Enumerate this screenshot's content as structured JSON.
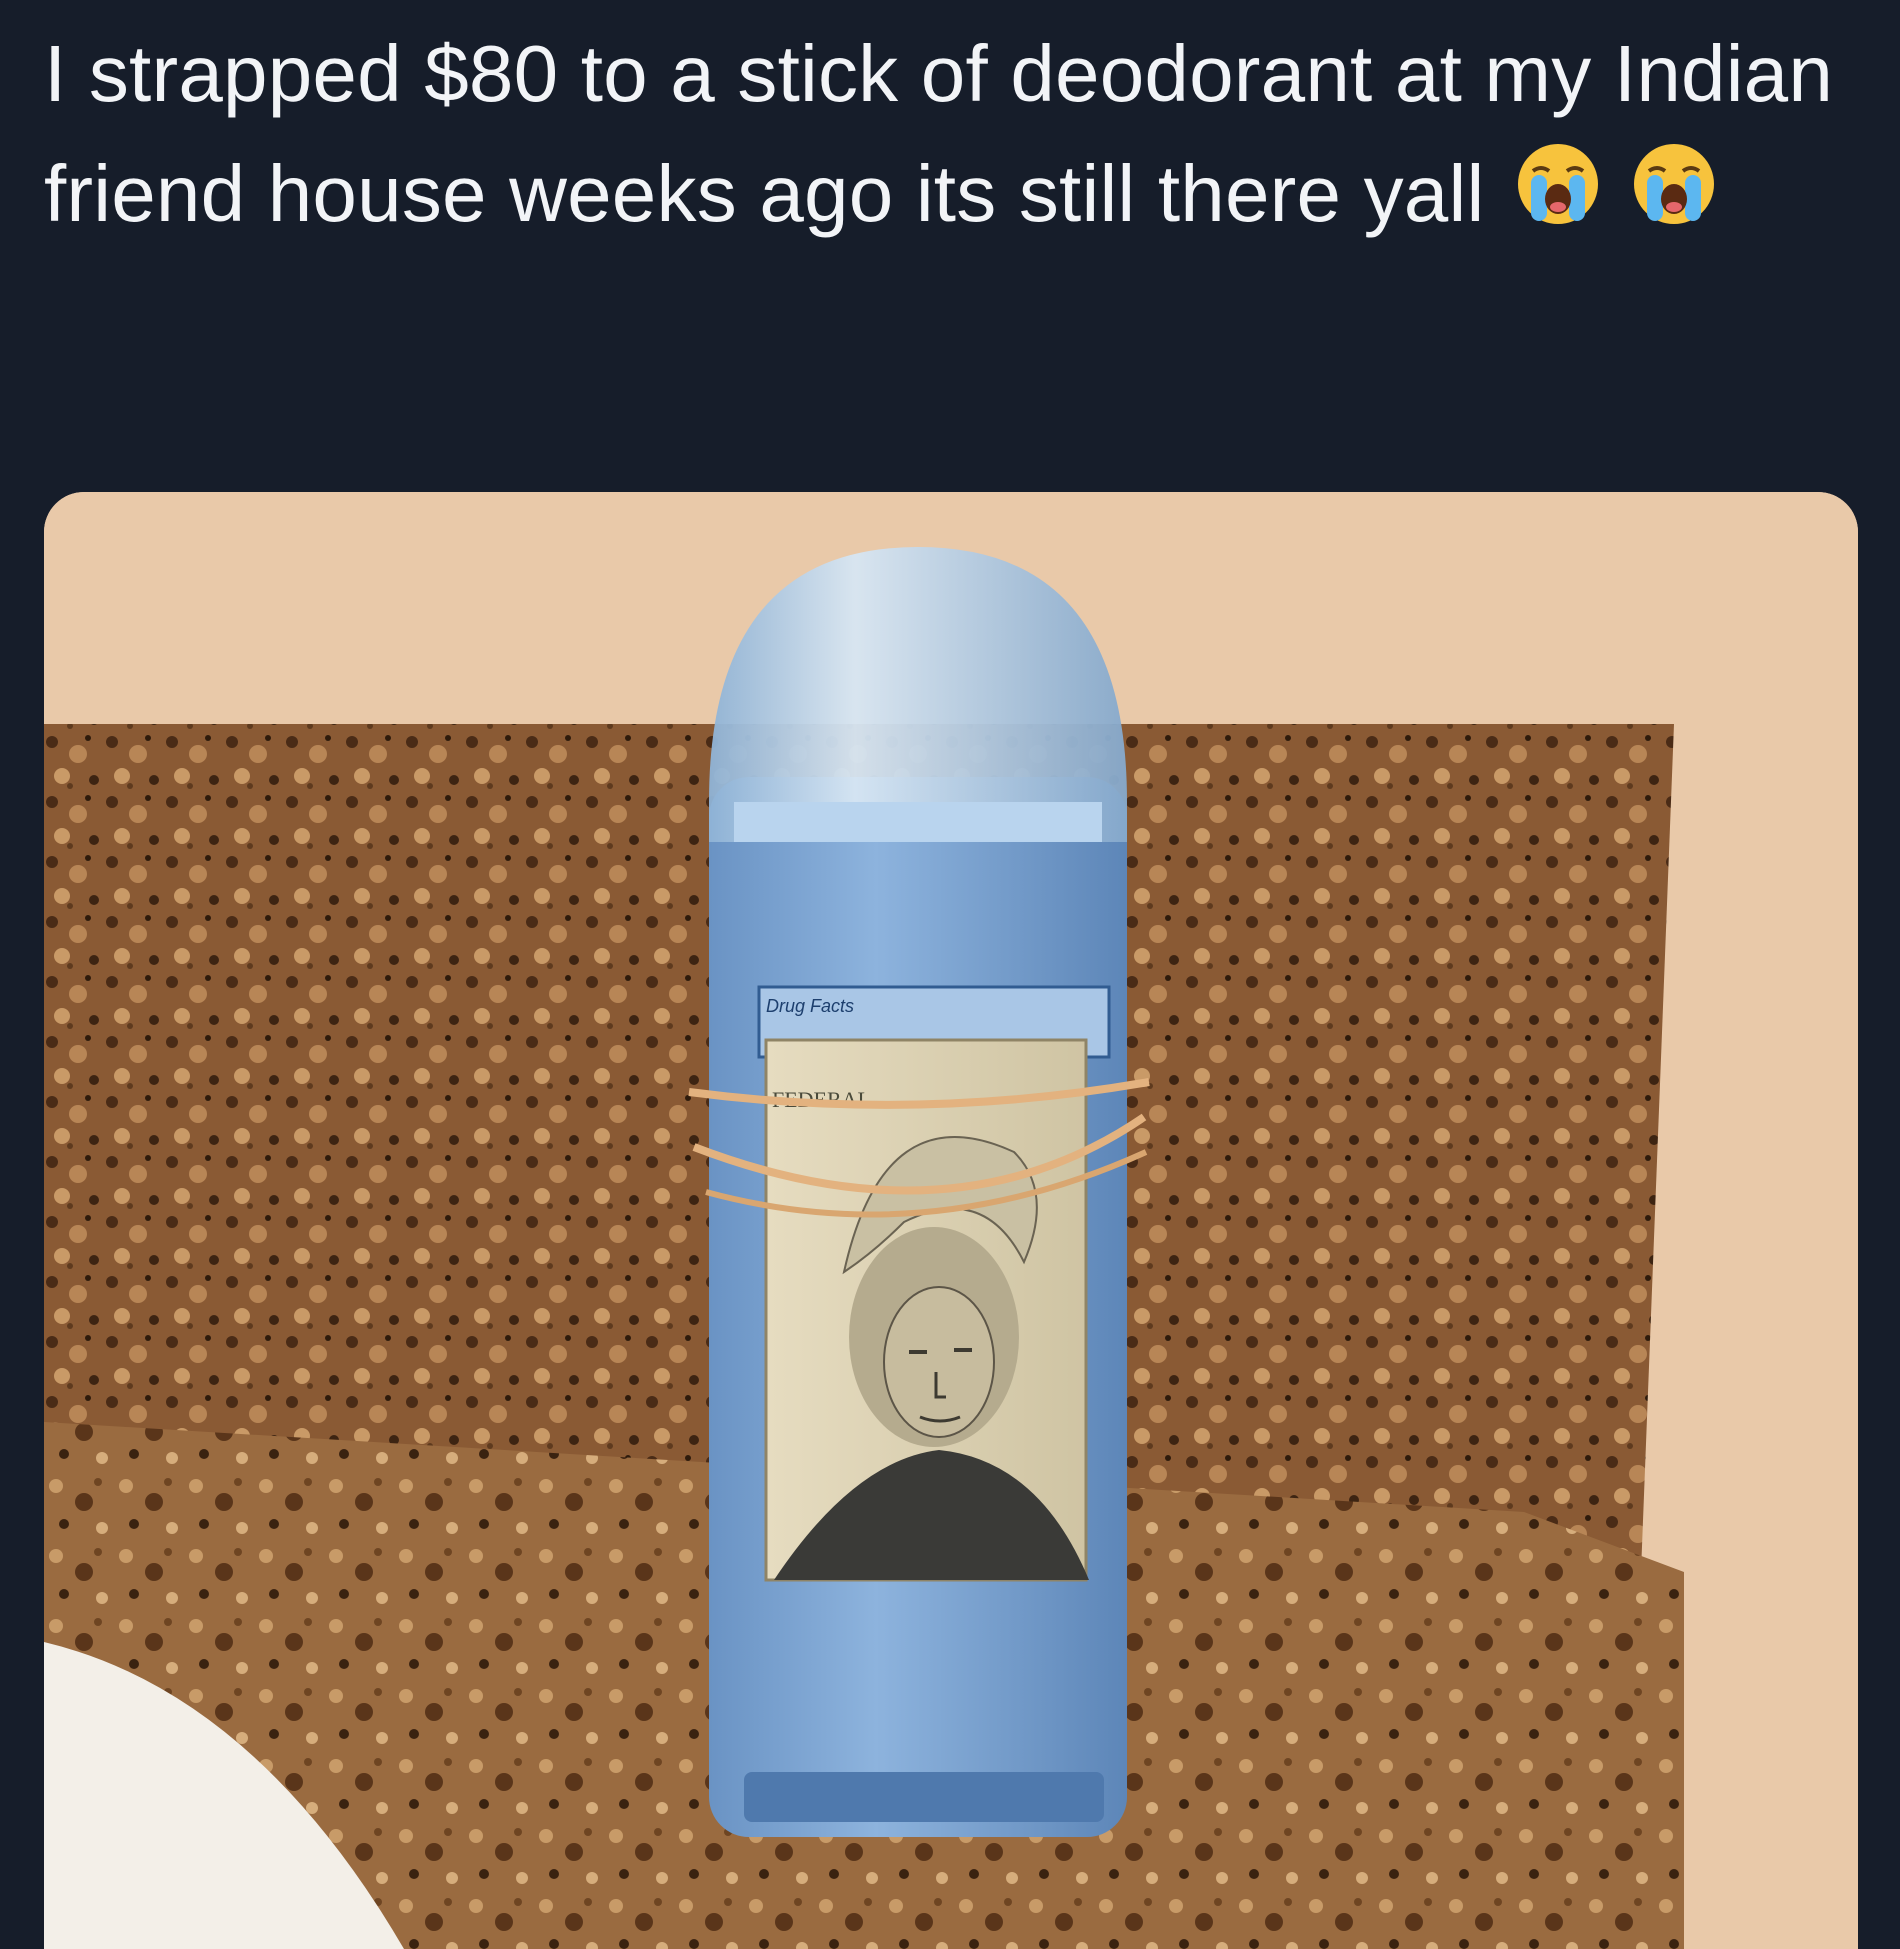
{
  "post": {
    "text": "I strapped $80 to a stick of deodorant at my Indian friend house weeks ago its still there yall",
    "emojis": [
      "loudly-crying-face-icon",
      "loudly-crying-face-icon"
    ]
  },
  "photo": {
    "label_text": "Drug Facts",
    "bill_text": "FEDERAL"
  },
  "colors": {
    "background": "#161d2a",
    "text": "#f2f4f7",
    "wall": "#e8c7a8",
    "granite": "#8a5a34",
    "deodorant_blue": "#7fa6d2",
    "bill": "#ddd5b8"
  }
}
